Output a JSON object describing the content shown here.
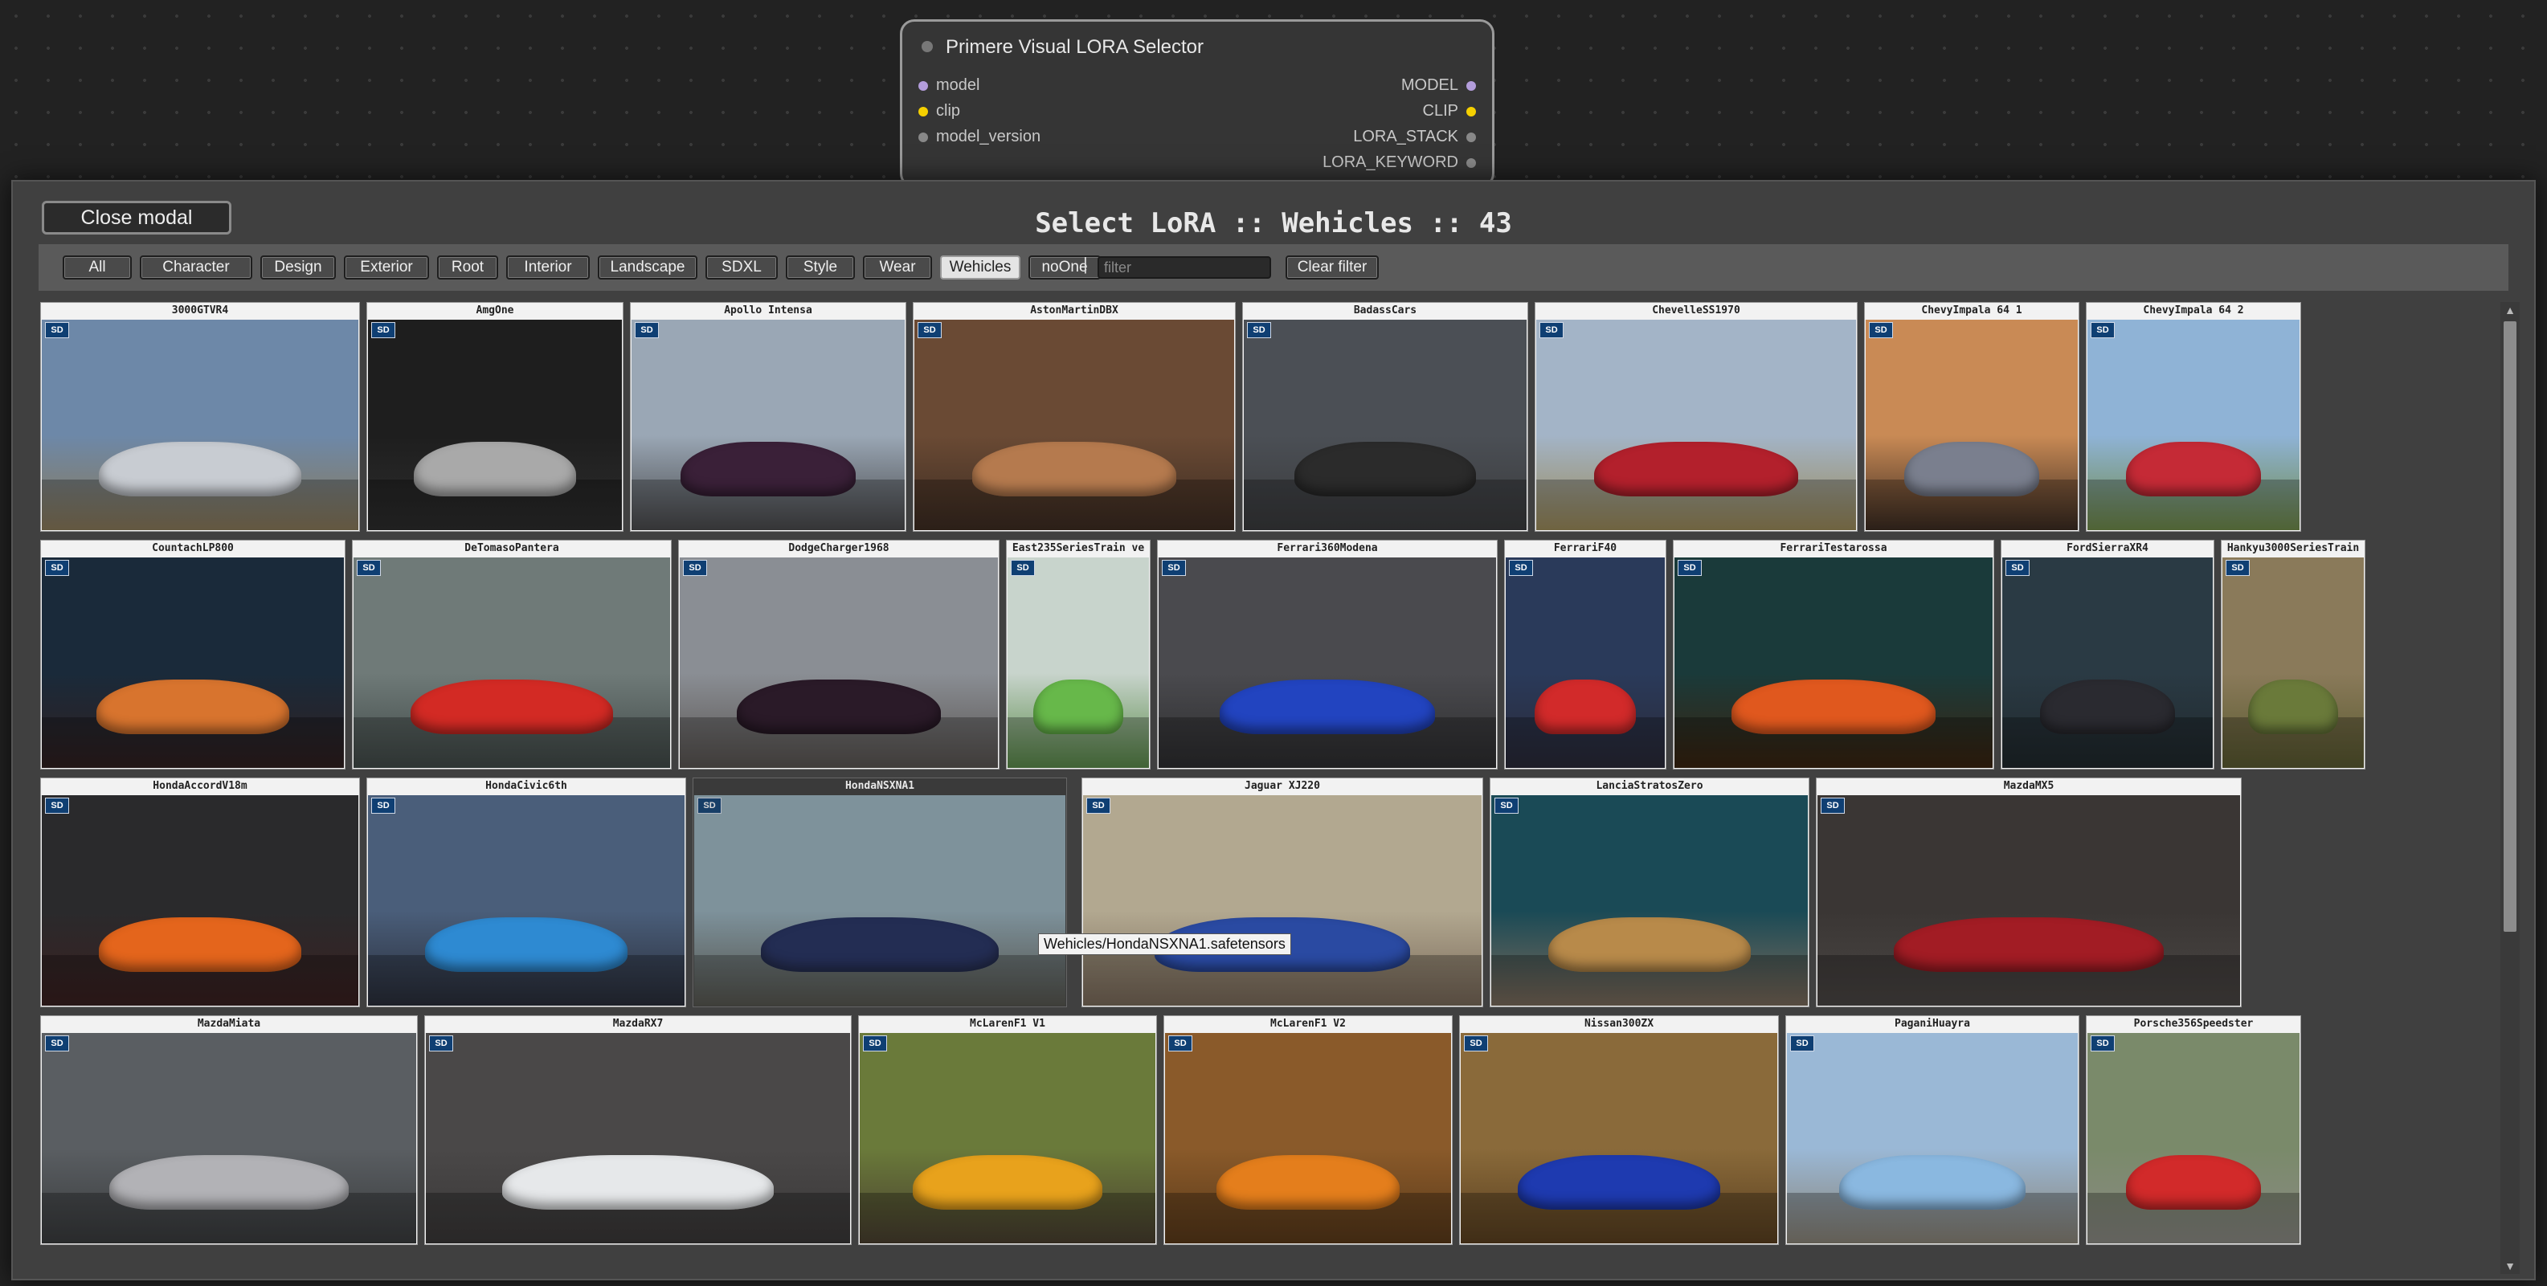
{
  "node": {
    "title": "Primere Visual LORA Selector",
    "inputs": [
      {
        "label": "model",
        "color": "#b39ddb"
      },
      {
        "label": "clip",
        "color": "#f5d000"
      },
      {
        "label": "model_version",
        "color": "#888888"
      }
    ],
    "outputs": [
      {
        "label": "MODEL",
        "color": "#b39ddb"
      },
      {
        "label": "CLIP",
        "color": "#f5d000"
      },
      {
        "label": "LORA_STACK",
        "color": "#888888"
      },
      {
        "label": "LORA_KEYWORD",
        "color": "#888888"
      }
    ]
  },
  "modal": {
    "close_label": "Close modal",
    "title": "Select LoRA :: Wehicles :: 43",
    "filters": [
      "All",
      "Character",
      "Design",
      "Exterior",
      "Root",
      "Interior",
      "Landscape",
      "SDXL",
      "Style",
      "Wear",
      "Wehicles",
      "noOne"
    ],
    "active_filter": "Wehicles",
    "separator": "|",
    "filter_placeholder": "filter",
    "clear_label": "Clear filter",
    "tooltip": "Wehicles/HondaNSXNA1.safetensors"
  },
  "badge": "SD",
  "cards": [
    {
      "name": "3000GTVR4",
      "bg": "#6d88a8",
      "ground": "#8a7a5a",
      "car": "#c8ccd2"
    },
    {
      "name": "AmgOne",
      "bg": "#1e1e1e",
      "ground": "#2d2d2d",
      "car": "#a9a9a9"
    },
    {
      "name": "Apollo Intensa",
      "bg": "#9aa7b5",
      "ground": "#4a4a4c",
      "car": "#3a2038"
    },
    {
      "name": "AstonMartinDBX",
      "bg": "#6a4a34",
      "ground": "#3d2c22",
      "car": "#b57a4e"
    },
    {
      "name": "BadassCars",
      "bg": "#4b4f55",
      "ground": "#3a3b3d",
      "car": "#2b2b2b"
    },
    {
      "name": "ChevelleSS1970",
      "bg": "#a3b4c7",
      "ground": "#9a8a5a",
      "car": "#b3202c"
    },
    {
      "name": "ChevyImpala 64 1",
      "bg": "#c98a55",
      "ground": "#3c2c22",
      "car": "#7a7f8e"
    },
    {
      "name": "ChevyImpala 64 2",
      "bg": "#8fb3d6",
      "ground": "#6f8a4a",
      "car": "#c52a36"
    },
    {
      "name": "CountachLP800",
      "bg": "#1a2a3a",
      "ground": "#302020",
      "car": "#d8742e"
    },
    {
      "name": "DeTomasoPantera",
      "bg": "#6f7a78",
      "ground": "#414a48",
      "car": "#d32a24"
    },
    {
      "name": "DodgeCharger1968",
      "bg": "#8a8e94",
      "ground": "#5a5552",
      "car": "#2a1a28"
    },
    {
      "name": "East235SeriesTrain ve",
      "bg": "#c8d4cc",
      "ground": "#5a8a4a",
      "car": "#67b84a"
    },
    {
      "name": "Ferrari360Modena",
      "bg": "#4a4a4e",
      "ground": "#2e2e30",
      "car": "#2244c0"
    },
    {
      "name": "FerrariF40",
      "bg": "#2a3a5a",
      "ground": "#2a2a38",
      "car": "#d22a2a"
    },
    {
      "name": "FerrariTestarossa",
      "bg": "#1a3a3a",
      "ground": "#3a2410",
      "car": "#e0581e"
    },
    {
      "name": "FordSierraXR4",
      "bg": "#2a3a44",
      "ground": "#20282c",
      "car": "#2a2a30"
    },
    {
      "name": "Hankyu3000SeriesTrain",
      "bg": "#8a7a5a",
      "ground": "#5a5a30",
      "car": "#6a7a3a"
    },
    {
      "name": "HondaAccordV18m",
      "bg": "#2a2a2c",
      "ground": "#3a2020",
      "car": "#e4651c"
    },
    {
      "name": "HondaCivic6th",
      "bg": "#4a5e7a",
      "ground": "#2a2e3a",
      "car": "#2e8ad2"
    },
    {
      "name": "HondaNSXNA1",
      "bg": "#8fa8b4",
      "ground": "#5a5a52",
      "car": "#1e2a5a",
      "dim": true
    },
    {
      "name": "Jaguar XJ220",
      "bg": "#b2a890",
      "ground": "#7a6a5a",
      "car": "#2a4aa2"
    },
    {
      "name": "LanciaStratosZero",
      "bg": "#1a4a56",
      "ground": "#7a6a5a",
      "car": "#b88a4a"
    },
    {
      "name": "MazdaMX5",
      "bg": "#3a3634",
      "ground": "#4a4644",
      "car": "#a21c24"
    },
    {
      "name": "MazdaMiata",
      "bg": "#5a5e62",
      "ground": "#3a3c3e",
      "car": "#b2b2b6"
    },
    {
      "name": "MazdaRX7",
      "bg": "#4a4848",
      "ground": "#3a3838",
      "car": "#e6e8ea"
    },
    {
      "name": "McLarenF1 V1",
      "bg": "#6a7a3a",
      "ground": "#4a4030",
      "car": "#e8a21c"
    },
    {
      "name": "McLarenF1 V2",
      "bg": "#8a5a2a",
      "ground": "#5a3a1a",
      "car": "#e47e1c"
    },
    {
      "name": "Nissan300ZX",
      "bg": "#8a6a3a",
      "ground": "#5a4020",
      "car": "#1e3ab0"
    },
    {
      "name": "PaganiHuayra",
      "bg": "#9ab8d6",
      "ground": "#8a8478",
      "car": "#8ab8e0"
    },
    {
      "name": "Porsche356Speedster",
      "bg": "#7a8a6a",
      "ground": "#8a8a84",
      "car": "#d22a2a"
    }
  ]
}
